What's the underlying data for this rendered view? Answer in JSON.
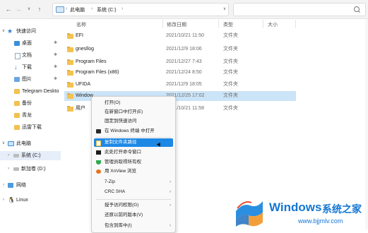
{
  "toolbar": {
    "back": "←",
    "forward": "→",
    "up": "↑",
    "refresh": "↻",
    "breadcrumb": [
      "此电脑",
      "系统 (C:)"
    ],
    "crumb_sep": "›"
  },
  "sidebar": {
    "items": [
      {
        "label": "快速访问",
        "icon": "star-icon",
        "chevron": "∨"
      },
      {
        "label": "桌面",
        "icon": "desktop-icon",
        "pin": "✱"
      },
      {
        "label": "文档",
        "icon": "document-icon",
        "pin": "✱"
      },
      {
        "label": "下载",
        "icon": "download-icon",
        "pin": "✱"
      },
      {
        "label": "图片",
        "icon": "pictures-icon",
        "pin": "✱"
      },
      {
        "label": "Telegram Deskto",
        "icon": "folder-icon"
      },
      {
        "label": "备份",
        "icon": "folder-icon"
      },
      {
        "label": "青龙",
        "icon": "folder-icon"
      },
      {
        "label": "迅雷下载",
        "icon": "folder-icon"
      },
      {
        "label": "此电脑",
        "icon": "pc-icon",
        "chevron": "∨"
      },
      {
        "label": "系统 (C:)",
        "icon": "drive-icon",
        "chevron": "›"
      },
      {
        "label": "新加卷 (D:)",
        "icon": "drive-icon",
        "chevron": "›"
      },
      {
        "label": "网络",
        "icon": "network-icon",
        "chevron": "›"
      },
      {
        "label": "Linux",
        "icon": "linux-icon",
        "chevron": "›"
      }
    ]
  },
  "columns": {
    "name": "名称",
    "date": "修改日期",
    "type": "类型",
    "size": "大小"
  },
  "files": [
    {
      "name": "EFI",
      "date": "2021/10/21 11:50",
      "type": "文件夹"
    },
    {
      "name": "gnesllog",
      "date": "2021/12/9 18:06",
      "type": "文件夹"
    },
    {
      "name": "Program Files",
      "date": "2021/12/27 7:43",
      "type": "文件夹"
    },
    {
      "name": "Program Files (x86)",
      "date": "2021/12/24 8:50",
      "type": "文件夹"
    },
    {
      "name": "UFIDA",
      "date": "2021/12/9 18:05",
      "type": "文件夹"
    },
    {
      "name": "Window",
      "date": "2021/12/25 17:02",
      "type": "文件夹"
    },
    {
      "name": "用户",
      "date": "2021/10/21 11:58",
      "type": "文件夹"
    }
  ],
  "menu": {
    "items": [
      {
        "label": "打开(O)"
      },
      {
        "label": "在新窗口中打开(E)"
      },
      {
        "label": "固定到快速访问"
      },
      {
        "label": "在 Windows 终端 中打开",
        "icon": "terminal-icon"
      },
      {
        "label": "复制文件夹路径",
        "icon": "copy-path-icon",
        "highlight": true
      },
      {
        "label": "此处打开命令窗口",
        "icon": "cmd-icon"
      },
      {
        "label": "管理员取得所有权",
        "icon": "shield-icon"
      },
      {
        "label": "用 XnView 浏览",
        "icon": "xnview-icon"
      },
      {
        "label": "7-Zip",
        "submenu": true
      },
      {
        "label": "CRC SHA",
        "submenu": true
      },
      {
        "label": "授予访问权限(G)",
        "submenu": true
      },
      {
        "label": "还原以前的版本(V)"
      },
      {
        "label": "包含到库中(I)",
        "submenu": true
      }
    ],
    "arrow": "›"
  },
  "watermark": {
    "title": "Windows",
    "subtitle": "系统之家",
    "url": "www.bjjmlv.com"
  },
  "colors": {
    "accent": "#1e88e5",
    "selection": "#cce4f7",
    "folder": "#f4c24e",
    "watermark": "#1477d4"
  }
}
